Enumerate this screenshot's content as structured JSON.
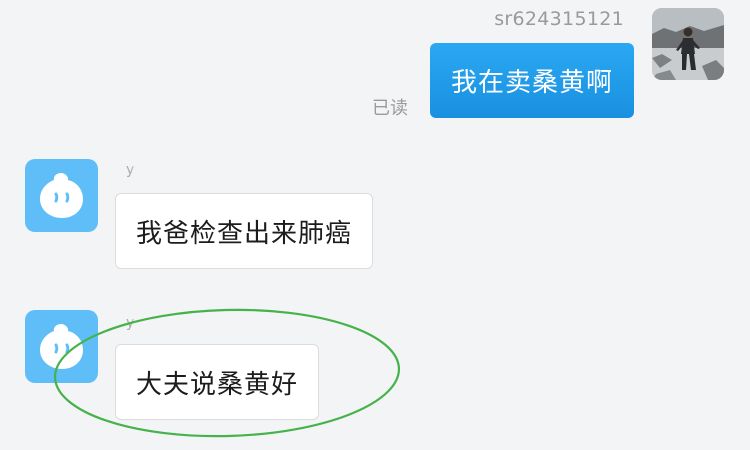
{
  "outgoing": {
    "sender_name": "sr624315121",
    "message": "我在卖桑黄啊",
    "read_status": "已读"
  },
  "incoming": [
    {
      "sender_name": "y",
      "message": "我爸检查出来肺癌"
    },
    {
      "sender_name": "y",
      "message": "大夫说桑黄好"
    }
  ],
  "colors": {
    "outgoing_bubble": "#1d99e8",
    "app_avatar": "#5fbef8",
    "annotation_ring": "#46b24a",
    "background": "#f3f4f6"
  }
}
